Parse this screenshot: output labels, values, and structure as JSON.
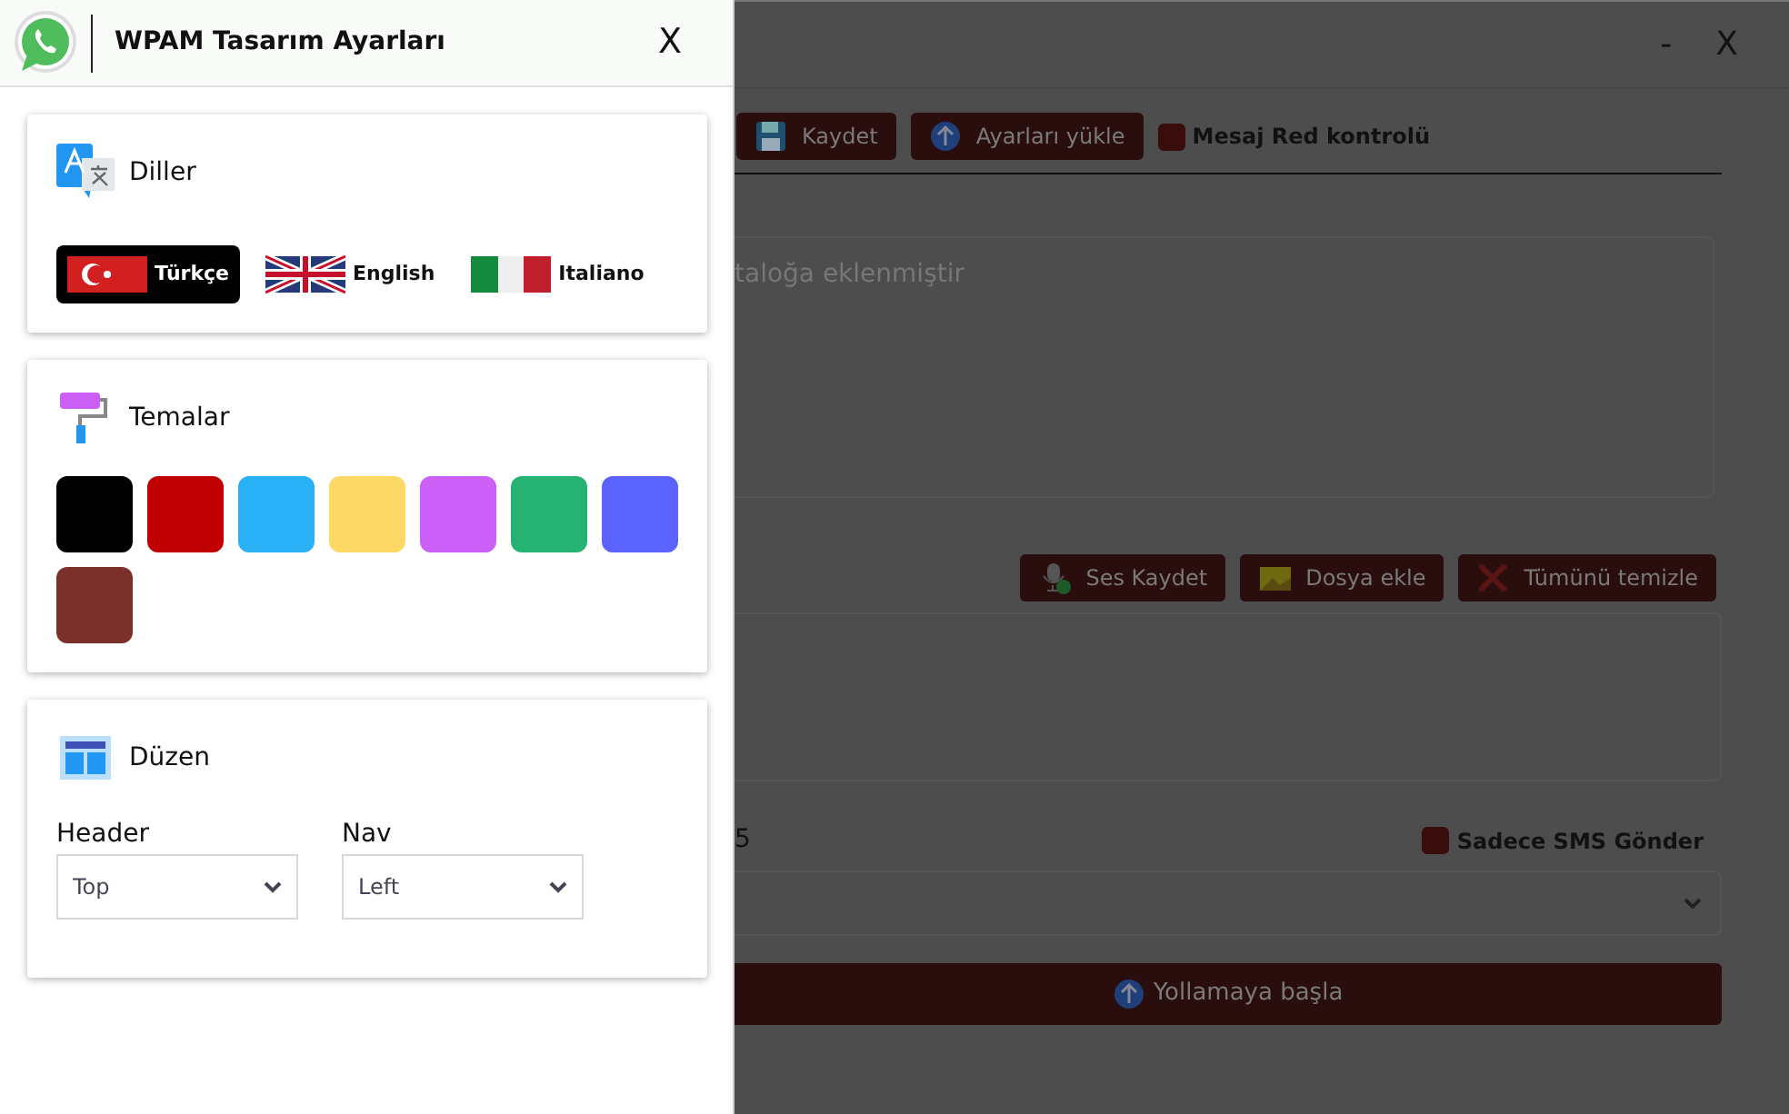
{
  "panel": {
    "title": "WPAM Tasarım Ayarları",
    "close": "X",
    "languages": {
      "heading": "Diller",
      "items": [
        {
          "label": "Türkçe",
          "kind": "tr",
          "selected": true
        },
        {
          "label": "English",
          "kind": "gb",
          "selected": false
        },
        {
          "label": "Italiano",
          "kind": "it",
          "selected": false
        }
      ]
    },
    "themes": {
      "heading": "Temalar",
      "swatches": [
        {
          "color": "#000000"
        },
        {
          "color": "#c00000"
        },
        {
          "color": "#2ab0f5"
        },
        {
          "color": "#ffd966"
        },
        {
          "color": "#cc5ff5"
        },
        {
          "color": "#25b273"
        },
        {
          "color": "#5b63fe"
        },
        {
          "color": "#7b3029"
        }
      ]
    },
    "layout": {
      "heading": "Düzen",
      "fields": [
        {
          "label": "Header",
          "value": "Top"
        },
        {
          "label": "Nav",
          "value": "Left"
        }
      ]
    }
  },
  "background": {
    "window_controls": [
      "-",
      "X"
    ],
    "toolbar": [
      {
        "label": "Kaydet",
        "kind": "save"
      },
      {
        "label": "Ayarları yükle",
        "kind": "upload"
      }
    ],
    "reject_check": {
      "label": "Mesaj Red kontrolü",
      "checked": false
    },
    "message_text": "taloğa eklenmiştir",
    "attach_buttons": [
      {
        "label": "Ses Kaydet",
        "kind": "mic"
      },
      {
        "label": "Dosya ekle",
        "kind": "image"
      },
      {
        "label": "Tümünü temizle",
        "kind": "clear"
      }
    ],
    "count_text": "5",
    "sms_check": {
      "label": "Sadece SMS Gönder",
      "checked": false
    },
    "start_button": "Yollamaya başla"
  }
}
